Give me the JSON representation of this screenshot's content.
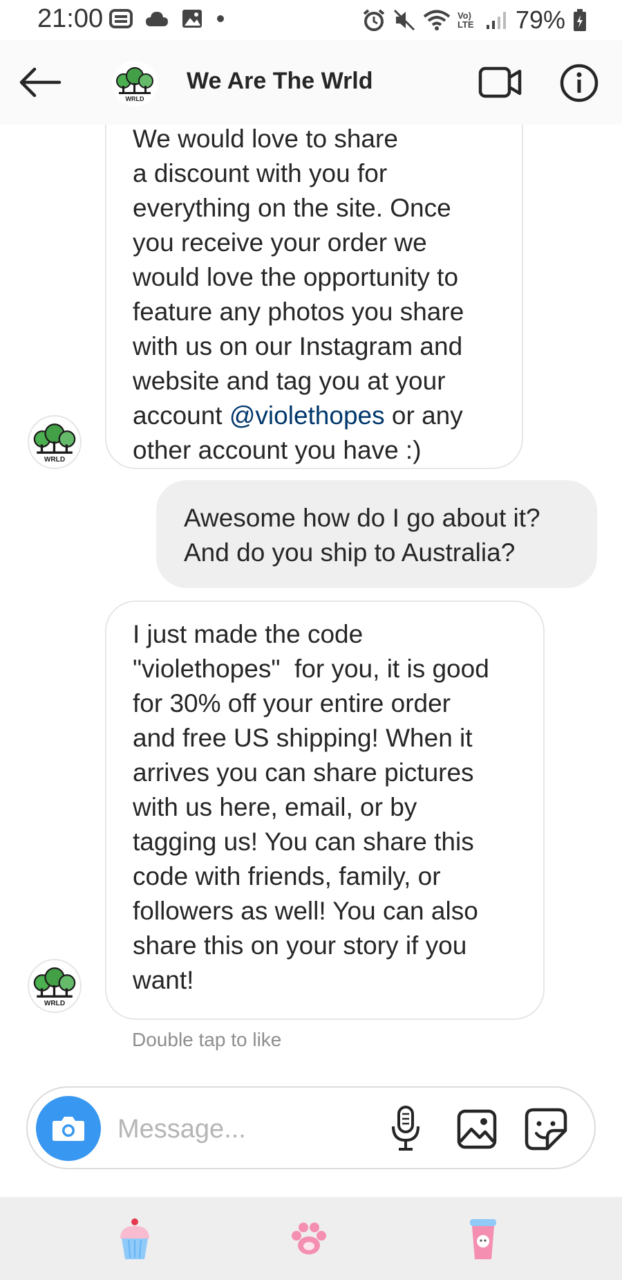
{
  "status_bar": {
    "time": "21:00",
    "battery": "79%",
    "lte_label": "Vo) LTE"
  },
  "header": {
    "title": "We Are The Wrld",
    "avatar_text": "WRLD"
  },
  "messages": [
    {
      "sender": "them",
      "text_before_mention": "We would love to share\na discount with you for\neverything on the site. Once\nyou receive your order we\nwould love the opportunity to\nfeature any photos you share\nwith us on our Instagram and\nwebsite and tag you at your\naccount ",
      "mention": "@violethopes",
      "text_after_mention": " or any\nother account you have :)"
    },
    {
      "sender": "me",
      "text": "Awesome how do I go about it?\nAnd do you ship to Australia?"
    },
    {
      "sender": "them",
      "text": "I just made the code\n\"violethopes\"  for you, it is good\nfor 30% off your entire order\nand free US shipping! When it\narrives you can share pictures\nwith us here, email, or by\ntagging us! You can share this\ncode with friends, family, or\nfollowers as well! You can also\nshare this on your story if you\nwant!"
    }
  ],
  "hint": "Double tap to like",
  "composer": {
    "placeholder": "Message..."
  },
  "icons": {
    "back": "back-arrow-icon",
    "video": "video-call-icon",
    "info": "info-icon",
    "camera": "camera-icon",
    "mic": "microphone-icon",
    "gallery": "gallery-icon",
    "sticker": "sticker-icon"
  },
  "colors": {
    "accent": "#3897f0",
    "mention": "#00376b",
    "outgoing_bubble": "#efefef",
    "logo_green": "#3fa34d"
  }
}
